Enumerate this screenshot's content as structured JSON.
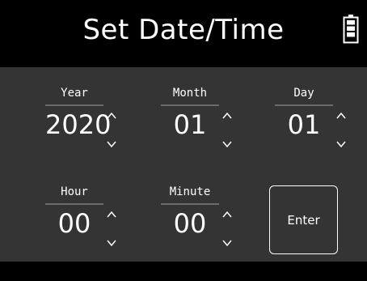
{
  "header": {
    "title": "Set Date/Time",
    "battery_icon": "battery-icon"
  },
  "fields": {
    "year": {
      "label": "Year",
      "value": "2020"
    },
    "month": {
      "label": "Month",
      "value": "01"
    },
    "day": {
      "label": "Day",
      "value": "01"
    },
    "hour": {
      "label": "Hour",
      "value": "00"
    },
    "minute": {
      "label": "Minute",
      "value": "00"
    }
  },
  "enter_label": "Enter",
  "icons": {
    "up": "chevron-up-icon",
    "down": "chevron-down-icon"
  },
  "colors": {
    "background": "#000000",
    "panel": "#343434",
    "text": "#ffffff",
    "divider": "#6a6a6a"
  }
}
